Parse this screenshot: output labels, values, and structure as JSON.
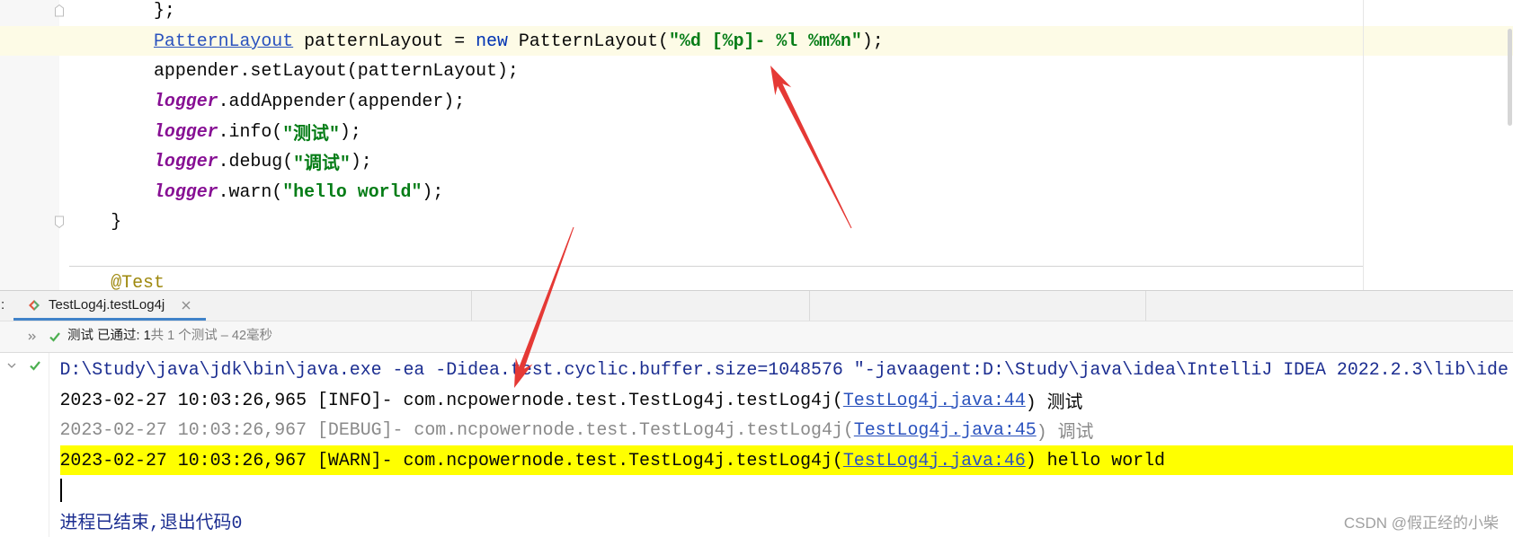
{
  "theme": {
    "keyword": "#0033b3",
    "string": "#067d17",
    "static_field": "#871094",
    "annotation": "#9e880d",
    "link": "#2a52be",
    "console_system": "#1c2e91",
    "console_debug": "#8a8a8a",
    "warn_highlight": "#ffff00",
    "caret_row": "#fdfbe6",
    "tab_underline": "#4083c9",
    "success_green": "#4caf50",
    "arrow_red": "#e53935",
    "watermark": "#a0a0a0"
  },
  "icons": {
    "fold": "fold-marker-icon",
    "run_tab": "test-run-icon",
    "close": "close-icon",
    "expand": "double-chevron-right-icon",
    "passed": "check-icon",
    "collapse": "chevron-down-icon"
  },
  "editor": {
    "lines": [
      [
        "};"
      ],
      [
        "PatternLayout",
        " patternLayout = ",
        "new",
        " PatternLayout(",
        "\"%d [%p]- %l %m%n\"",
        ");"
      ],
      [
        "appender.setLayout(patternLayout);"
      ],
      [
        "logger",
        ".addAppender(appender);"
      ],
      [
        "logger",
        ".info(",
        "\"测试\"",
        ");"
      ],
      [
        "logger",
        ".debug(",
        "\"调试\"",
        ");"
      ],
      [
        "logger",
        ".warn(",
        "\"hello world\"",
        ");"
      ],
      [
        "}"
      ],
      [],
      [
        "@Test"
      ]
    ]
  },
  "run_panel": {
    "run_label_tail": ":",
    "tab_label": "TestLog4j.testLog4j",
    "status_label": "测试 已通过: 1",
    "status_detail": "共 1 个测试 – 42毫秒"
  },
  "console": {
    "command": "D:\\Study\\java\\jdk\\bin\\java.exe -ea -Didea.test.cyclic.buffer.size=1048576 \"-javaagent:D:\\Study\\java\\idea\\IntelliJ IDEA 2022.2.3\\lib\\ide",
    "log_lines": [
      {
        "prefix": "2023-02-27 10:03:26,965 [INFO]- com.ncpowernode.test.TestLog4j.testLog4j(",
        "link": "TestLog4j.java:44",
        "suffix": ") 测试"
      },
      {
        "prefix": "2023-02-27 10:03:26,967 [DEBUG]- com.ncpowernode.test.TestLog4j.testLog4j(",
        "link": "TestLog4j.java:45",
        "suffix": ") 调试"
      },
      {
        "prefix": "2023-02-27 10:03:26,967 [WARN]- com.ncpowernode.test.TestLog4j.testLog4j(",
        "link": "TestLog4j.java:46",
        "suffix": ") hello world"
      }
    ],
    "exit_message": "进程已结束,退出代码0"
  },
  "watermark": "CSDN @假正经的小柴"
}
